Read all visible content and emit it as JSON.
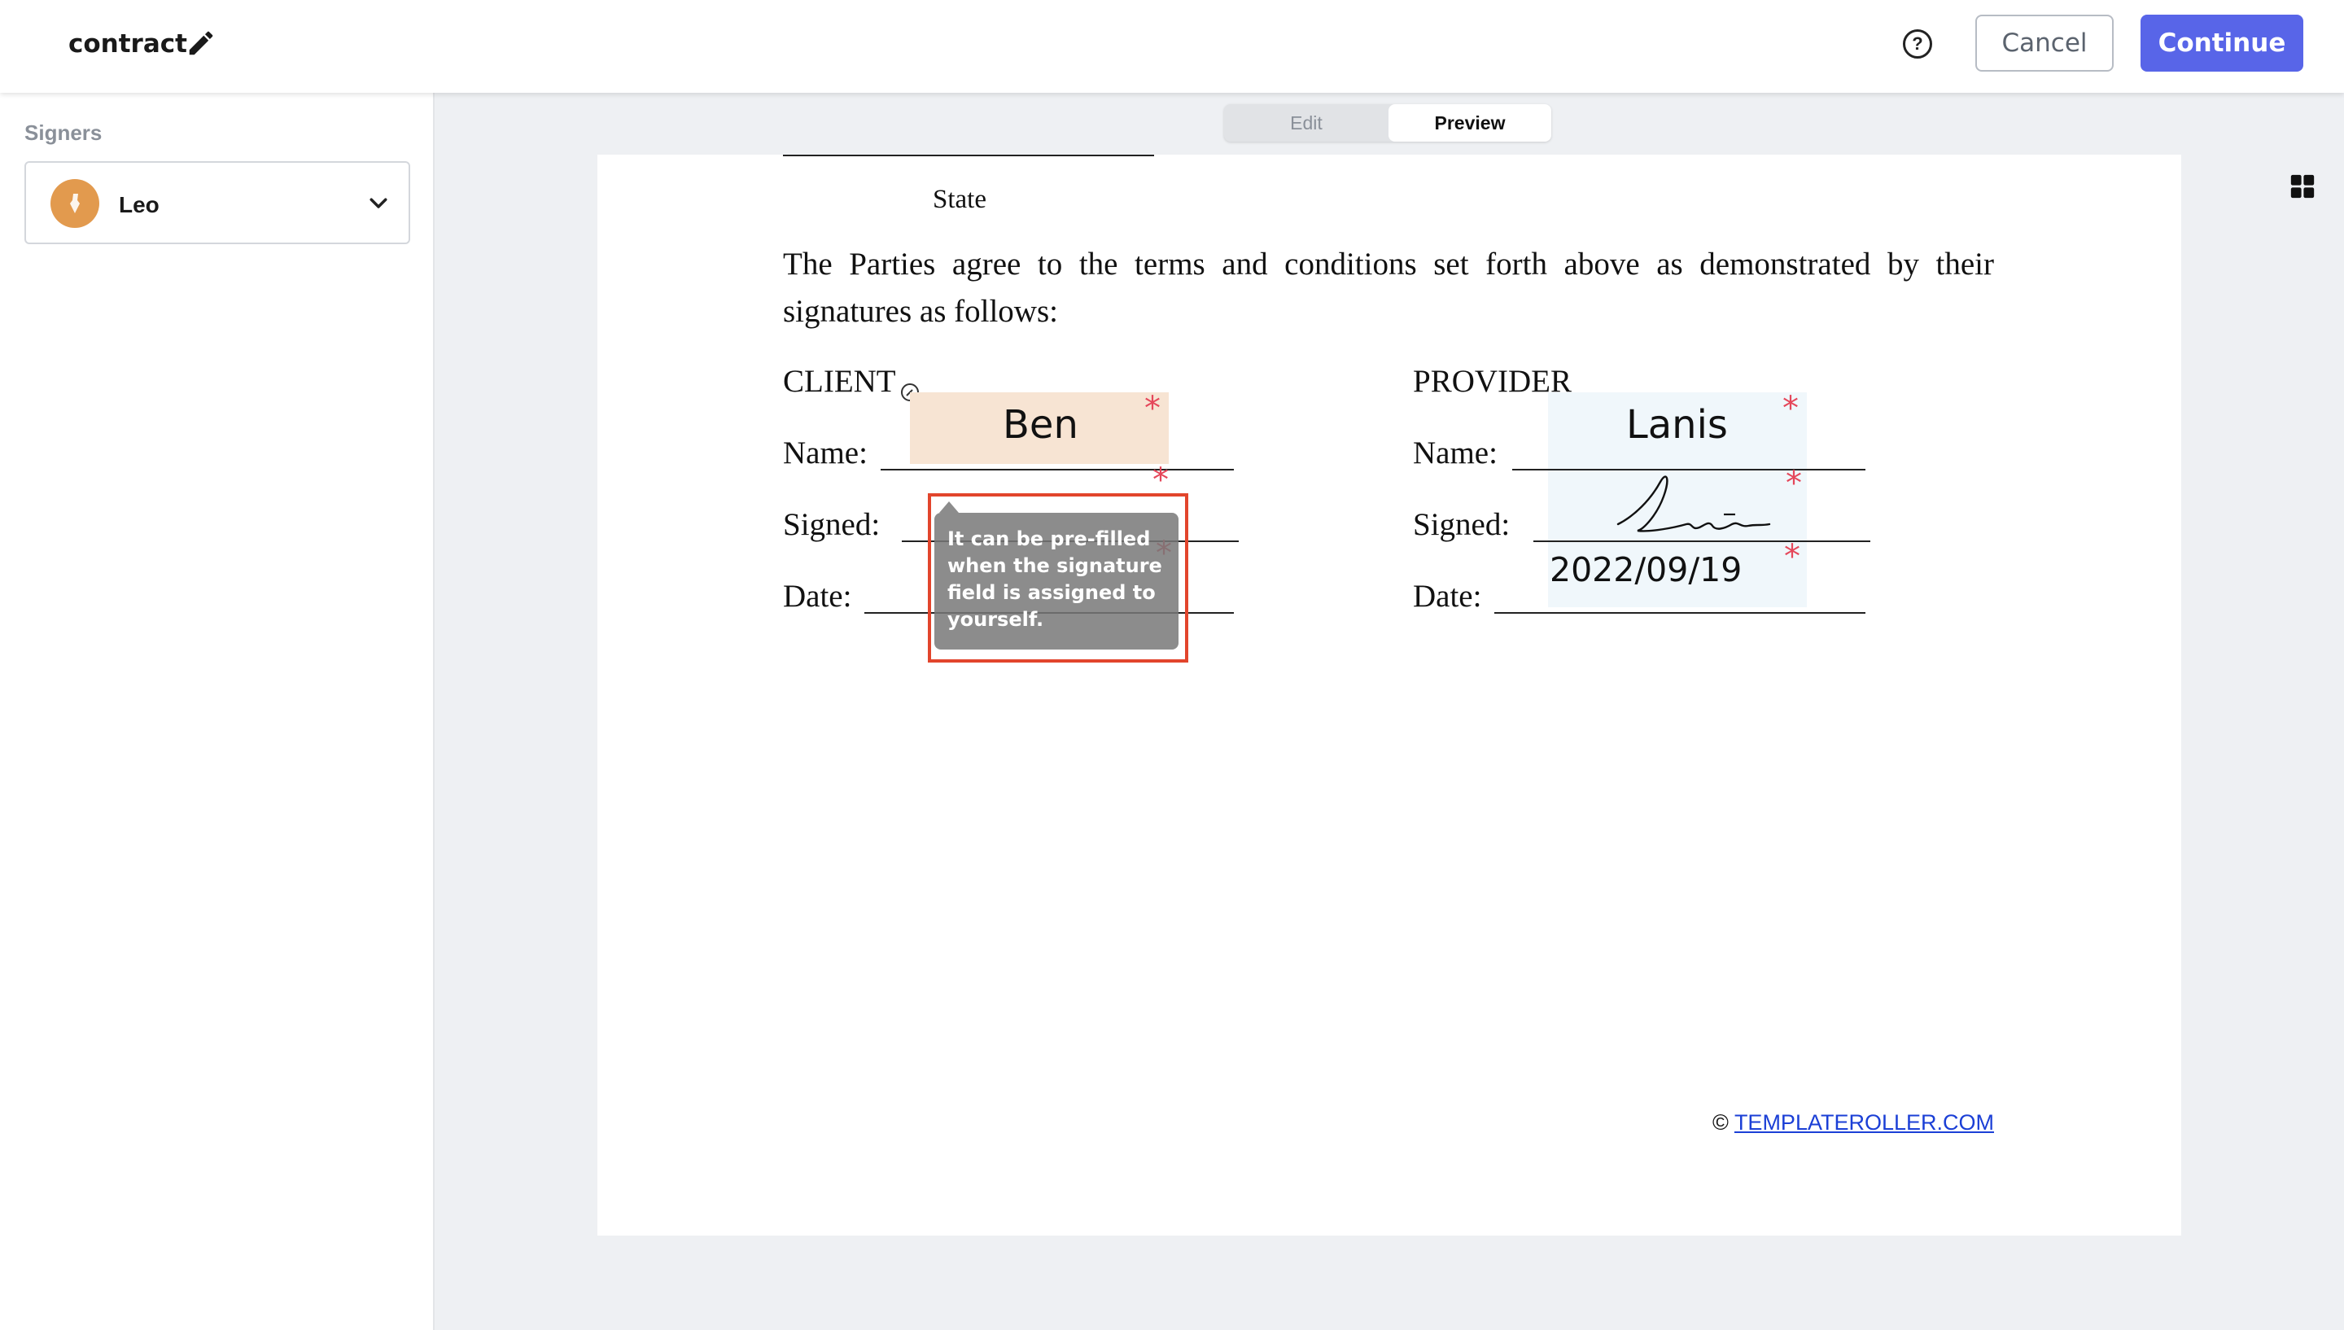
{
  "header": {
    "title": "contract",
    "cancel_label": "Cancel",
    "continue_label": "Continue",
    "accent_color": "#5865e8"
  },
  "sidebar": {
    "section_label": "Signers",
    "selected_signer": "Leo",
    "avatar_color": "#e29a4e"
  },
  "mode_toggle": {
    "edit_label": "Edit",
    "preview_label": "Preview",
    "active": "Preview"
  },
  "document": {
    "state_label": "State",
    "agreement_text": "The Parties agree to the terms and conditions set forth above as demonstrated by their signatures as follows:",
    "client": {
      "heading": "CLIENT",
      "name_label": "Name:",
      "signed_label": "Signed:",
      "date_label": "Date:",
      "name_value": "Ben"
    },
    "provider": {
      "heading": "PROVIDER",
      "name_label": "Name:",
      "signed_label": "Signed:",
      "date_label": "Date:",
      "name_value": "Lanis",
      "date_value": "2022/09/19"
    },
    "required_marker": "*",
    "tooltip_text": "It can be pre-filled when the signature field is assigned to yourself.",
    "footer_prefix": "©",
    "footer_link": "TEMPLATEROLLER.COM"
  }
}
